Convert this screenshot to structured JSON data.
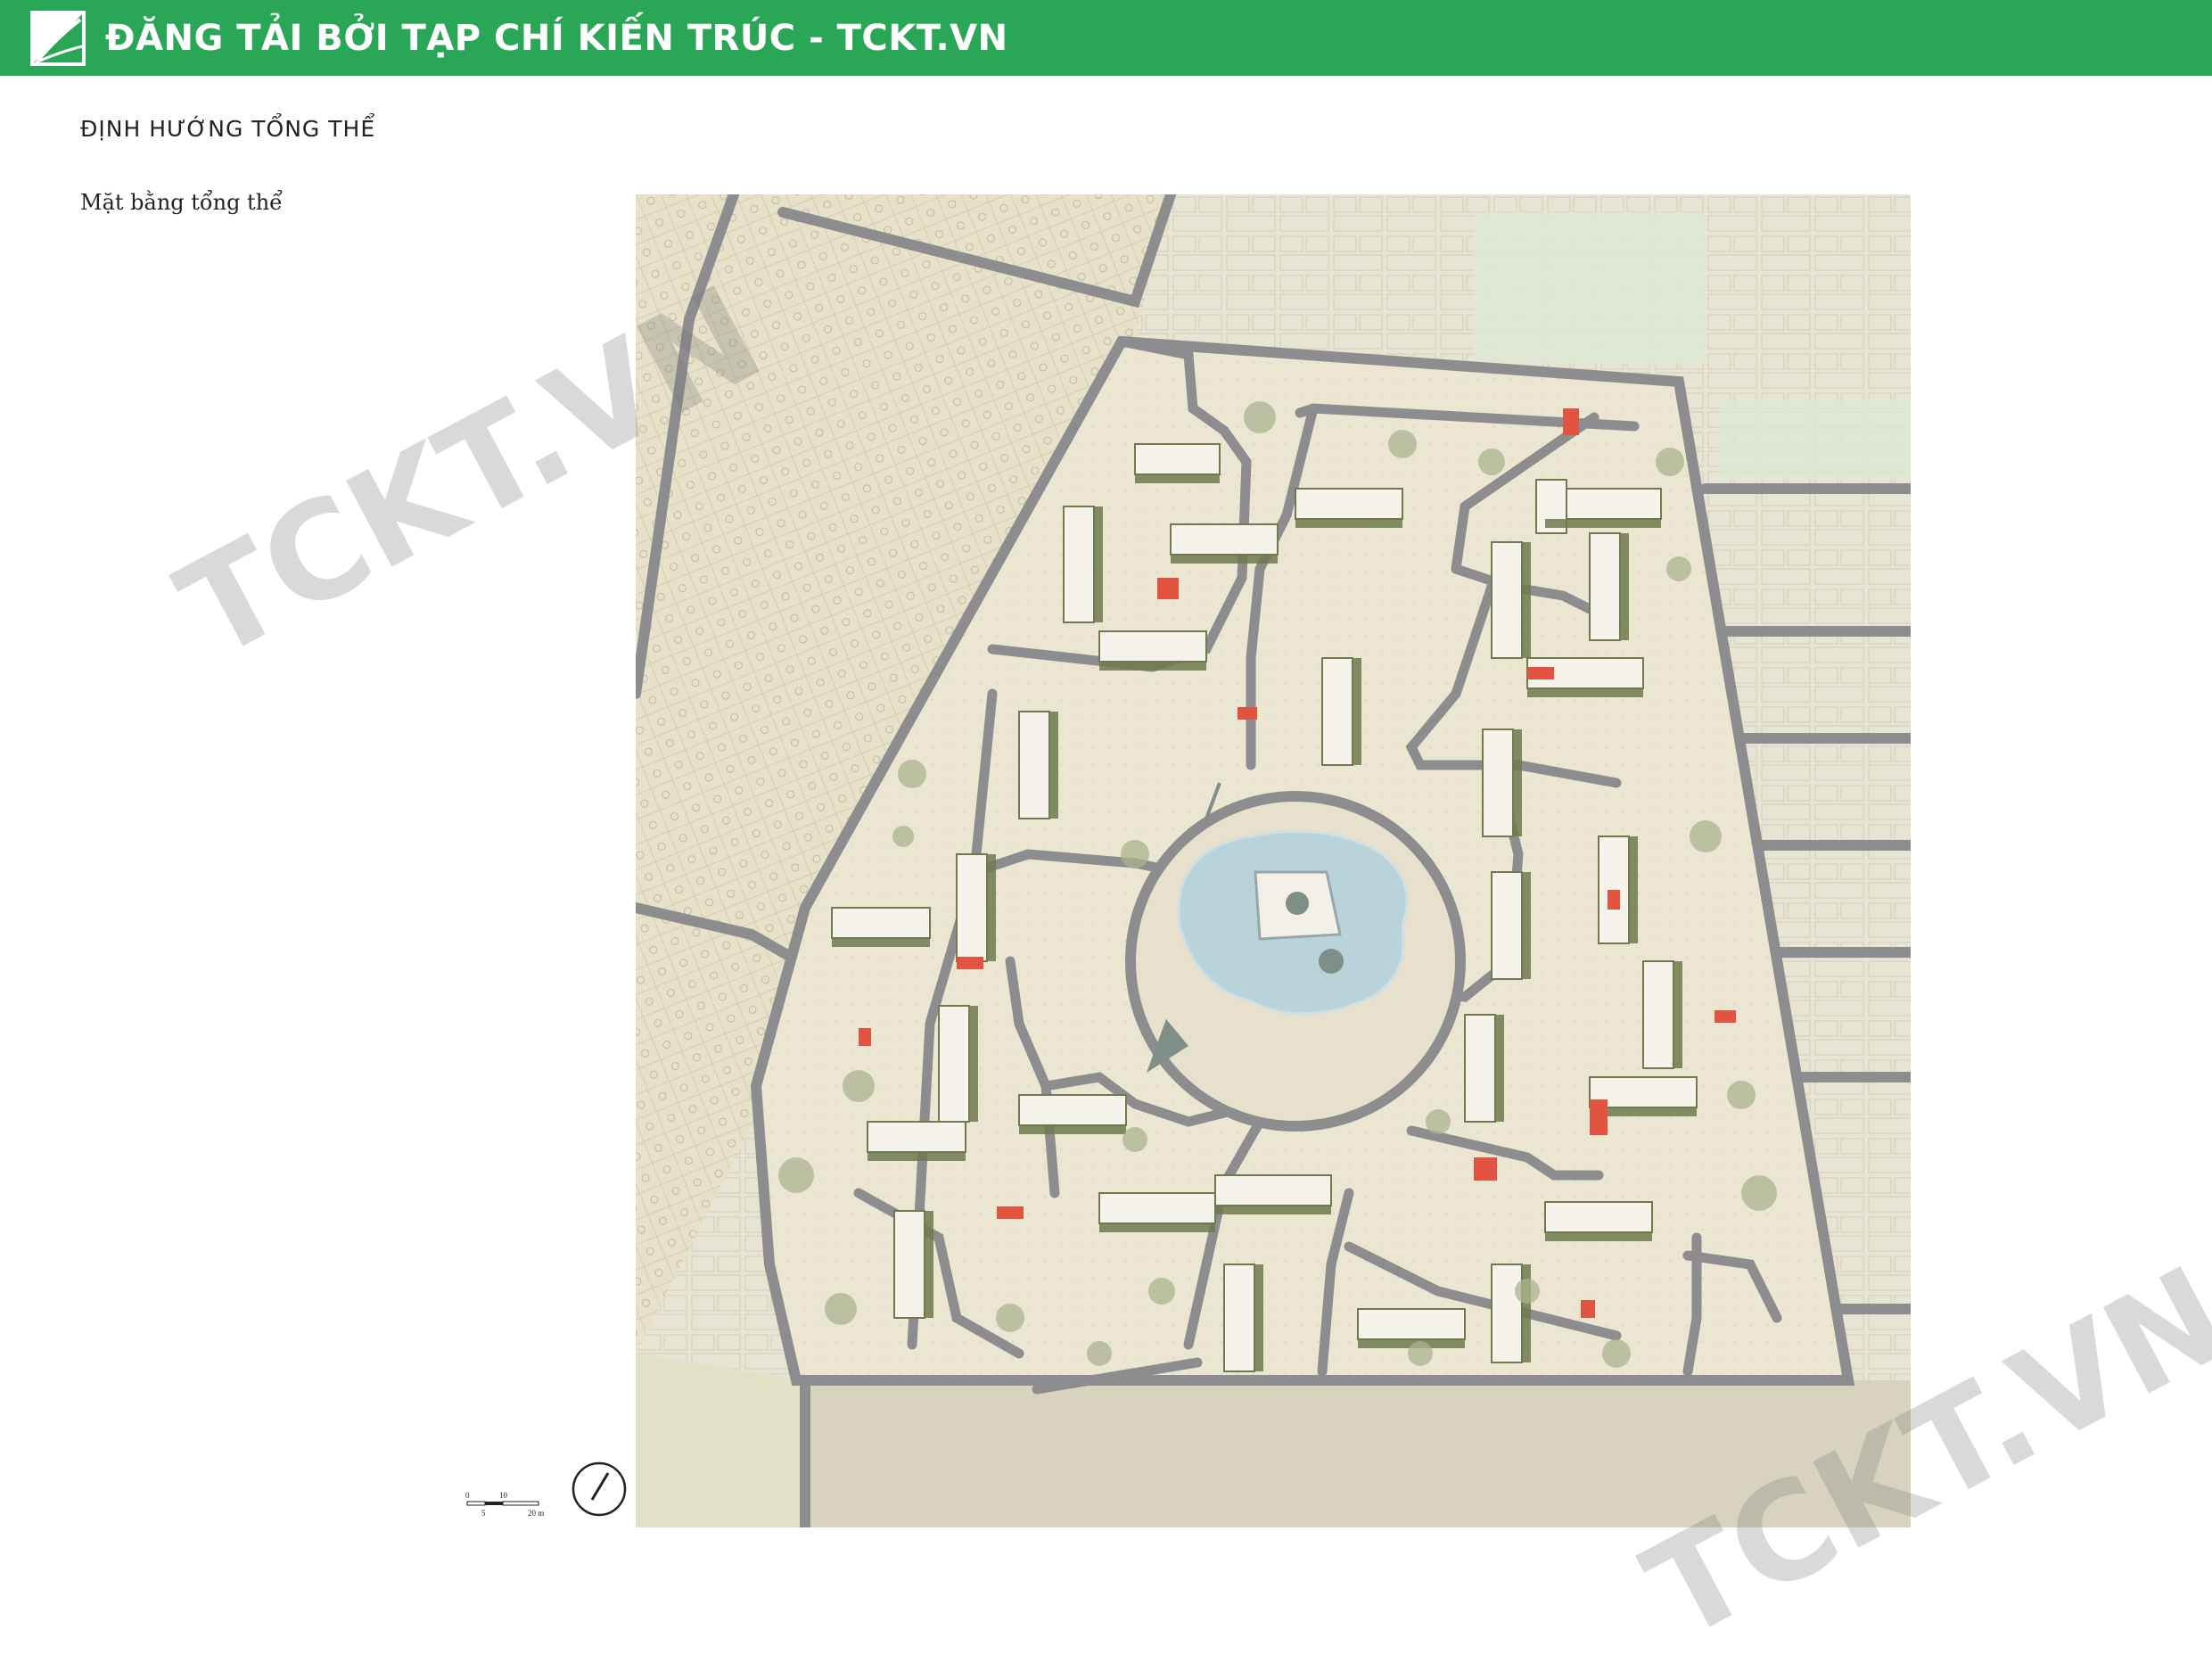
{
  "banner": {
    "text": "ĐĂNG TẢI BỞI TẠP CHÍ KIẾN TRÚC - TCKT.VN",
    "logo_icon": "tckt-logo-icon",
    "color": "#2aa756"
  },
  "section_title": "ĐỊNH HƯỚNG TỔNG THỂ",
  "sub_title": "Mặt bằng tổng thể",
  "scale_bar": {
    "labels": [
      "0",
      "5",
      "10",
      "20 m"
    ]
  },
  "compass_icon": "north-arrow-icon",
  "watermarks": [
    "TCKT.VN",
    "TCKT.VN"
  ],
  "colors": {
    "road": "#8d8d8f",
    "ground": "#e9e4cf",
    "surroundings": "#e2ddc2",
    "water": "#b8d3da",
    "roof": "#f4f2ea",
    "roof_dark": "#6f7a4d",
    "accent": "#e2543f"
  }
}
